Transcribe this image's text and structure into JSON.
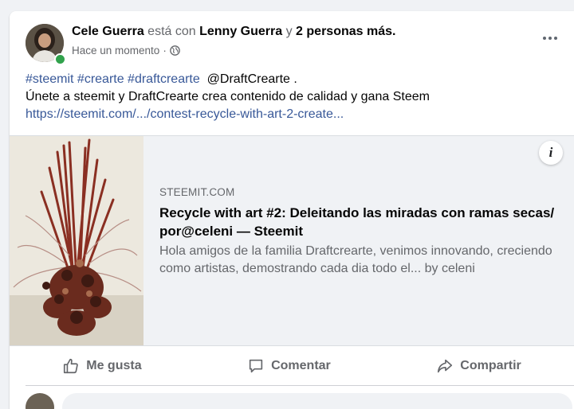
{
  "post": {
    "author": "Cele Guerra",
    "with_text": "está con",
    "tagged": "Lenny Guerra",
    "and_text": "y",
    "others": "2 personas más.",
    "timestamp": "Hace un momento",
    "separator": "·",
    "privacy_icon": "globe-icon",
    "more_icon": "more-options-icon",
    "hashtags": "#steemit #crearte #draftcrearte",
    "mention": "@DraftCrearte .",
    "body_line": "Únete a steemit y DraftCrearte crea contenido de calidad y gana Steem",
    "link_text": "https://steemit.com/.../contest-recycle-with-art-2-create..."
  },
  "preview": {
    "info_label": "i",
    "domain": "STEEMIT.COM",
    "title": "Recycle with art #2: Deleitando las miradas con ramas secas/ por@celeni — Steemit",
    "description": "Hola amigos de la familia Draftcrearte, venimos innovando, creciendo como artistas, demostrando cada dia todo el... by celeni"
  },
  "actions": {
    "like": "Me gusta",
    "comment": "Comentar",
    "share": "Compartir"
  },
  "colors": {
    "link": "#385898",
    "online": "#31a24c",
    "background": "#f0f2f5"
  }
}
